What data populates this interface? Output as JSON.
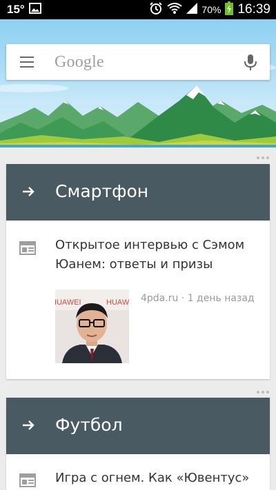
{
  "status_bar": {
    "temperature": "15°",
    "battery_percent": "70%",
    "time": "16:39"
  },
  "search": {
    "placeholder": "Google"
  },
  "cards": [
    {
      "title": "Смартфон",
      "article_title": "Открытое интервью с Сэмом Юанем: ответы и призы",
      "meta": "4pda.ru · 1 день назад",
      "thumb_text": "HUAWEI"
    },
    {
      "title": "Футбол",
      "article_title": "Игра с огнем. Как «Ювентус»"
    }
  ],
  "icons": [
    "image-icon",
    "alarm-icon",
    "wifi-icon",
    "signal-icon",
    "battery-icon",
    "menu-icon",
    "mic-icon",
    "arrow-right-icon",
    "news-icon",
    "more-icon"
  ],
  "colors": {
    "card_header": "#4a5a63",
    "background": "#ececec",
    "statusbar": "#000000"
  }
}
